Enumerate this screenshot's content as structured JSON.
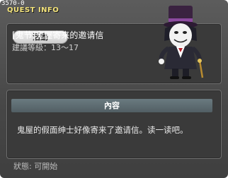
{
  "window": {
    "quest_code": "3570-0",
    "title": "QUEST INFO"
  },
  "quest": {
    "category_badge": "活動",
    "name": "[鬼节]鬼屋寄来的邀请信",
    "level_label": "建議等級：13～17"
  },
  "content": {
    "header": "內容",
    "description": "鬼屋的假面绅士好像寄来了邀请信。读一读吧。"
  },
  "status": {
    "text": "狀態:  可開始"
  },
  "icons": {
    "npc_portrait": "masked-gentleman-npc-icon",
    "close": "close-icon"
  },
  "colors": {
    "title": "#f2e27a",
    "background": "#474747",
    "panel": "#3a3a3a",
    "content_header": "#5e6c71"
  }
}
